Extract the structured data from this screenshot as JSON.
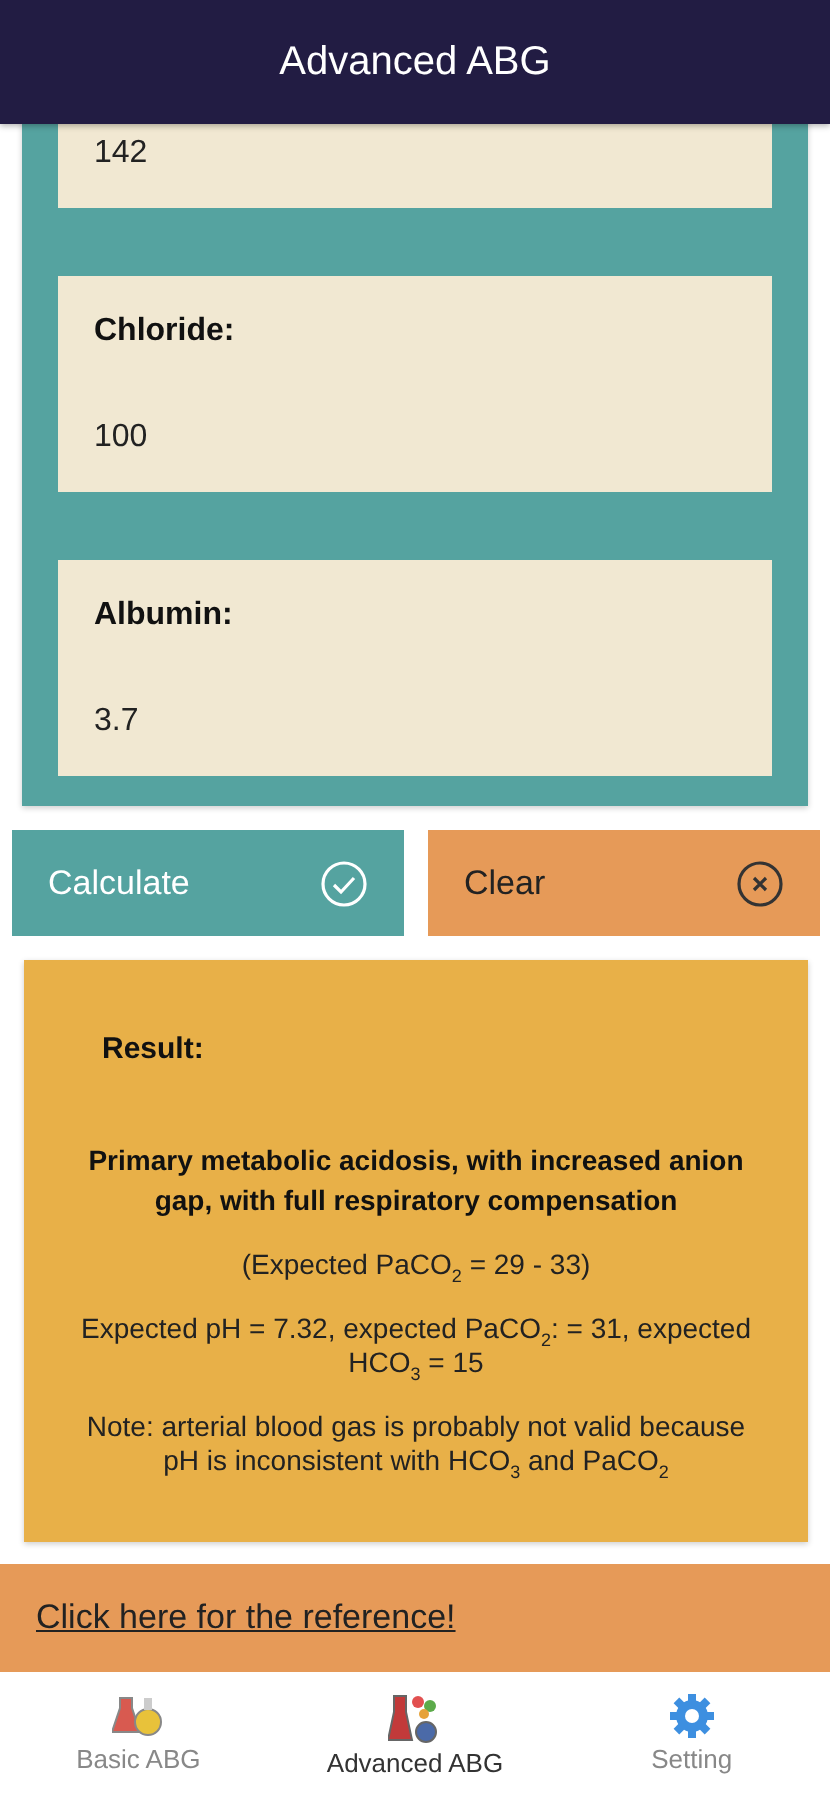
{
  "header": {
    "title": "Advanced ABG"
  },
  "fields": [
    {
      "value": "142"
    },
    {
      "label": "Chloride:",
      "value": "100"
    },
    {
      "label": "Albumin:",
      "value": "3.7"
    }
  ],
  "buttons": [
    {
      "kind": "calculate",
      "label": "Calculate"
    },
    {
      "kind": "clear",
      "label": "Clear"
    }
  ],
  "result": {
    "title": "Result:",
    "diagnosis": "Primary metabolic acidosis, with increased anion gap, with full respiratory compensation",
    "lines": [
      "(Expected PaCO$_{2}$ = 29 - 33)",
      "Expected pH = 7.32, expected PaCO$_{2}$: = 31, expected HCO$_{3}$ = 15",
      "Note: arterial blood gas is probably not valid because pH is inconsistent with HCO$_{3}$ and PaCO$_{2}$"
    ]
  },
  "reference_link": "Click here for the reference!",
  "tabs": [
    {
      "kind": "basic",
      "label": "Basic ABG",
      "selected": false
    },
    {
      "kind": "advanced",
      "label": "Advanced ABG",
      "selected": true
    },
    {
      "kind": "setting",
      "label": "Setting",
      "selected": false
    }
  ]
}
